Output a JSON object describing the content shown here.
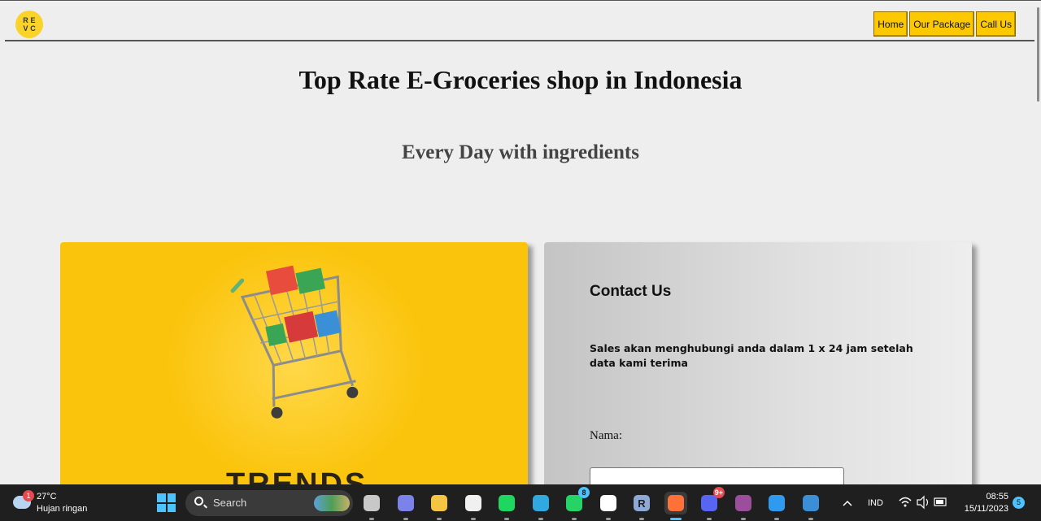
{
  "nav": {
    "logo_letters": [
      "R",
      "E",
      "V",
      "C"
    ],
    "links": [
      "Home",
      "Our Package",
      "Call Us"
    ]
  },
  "hero": {
    "title": "Top Rate E-Groceries shop in Indonesia",
    "subtitle": "Every Day with ingredients",
    "image_caption": "TRENDS"
  },
  "contact": {
    "title": "Contact Us",
    "description": "Sales akan menghubungi anda dalam 1 x 24 jam setelah data kami terima",
    "name_label": "Nama:",
    "name_value": ""
  },
  "taskbar": {
    "weather_badge": "1",
    "weather_temp": "27°C",
    "weather_desc": "Hujan ringan",
    "search_label": "Search",
    "apps": [
      {
        "name": "task-view",
        "label": "",
        "color": "#c8c8c8"
      },
      {
        "name": "chat",
        "label": "",
        "color": "#7b83eb"
      },
      {
        "name": "file-explorer",
        "label": "",
        "color": "#f4c542"
      },
      {
        "name": "microsoft-store",
        "label": "",
        "color": "#f0f0f0"
      },
      {
        "name": "spotify",
        "label": "",
        "color": "#1ed760"
      },
      {
        "name": "edge",
        "label": "",
        "color": "#2fa9e0"
      },
      {
        "name": "whatsapp",
        "label": "",
        "color": "#25d366",
        "badge": "8"
      },
      {
        "name": "capcut",
        "label": "",
        "color": "#ffffff"
      },
      {
        "name": "r-app",
        "label": "R",
        "color": "#8fa9d6"
      },
      {
        "name": "firefox",
        "label": "",
        "color": "#ff7139"
      },
      {
        "name": "discord",
        "label": "",
        "color": "#5865f2",
        "badge": "9+"
      },
      {
        "name": "winrar",
        "label": "",
        "color": "#9b4f9a"
      },
      {
        "name": "vscode",
        "label": "",
        "color": "#2f9bf0"
      },
      {
        "name": "photos",
        "label": "",
        "color": "#3b8fd6"
      }
    ],
    "language": "IND",
    "time": "08:55",
    "date": "15/11/2023",
    "notification_count": "5"
  }
}
